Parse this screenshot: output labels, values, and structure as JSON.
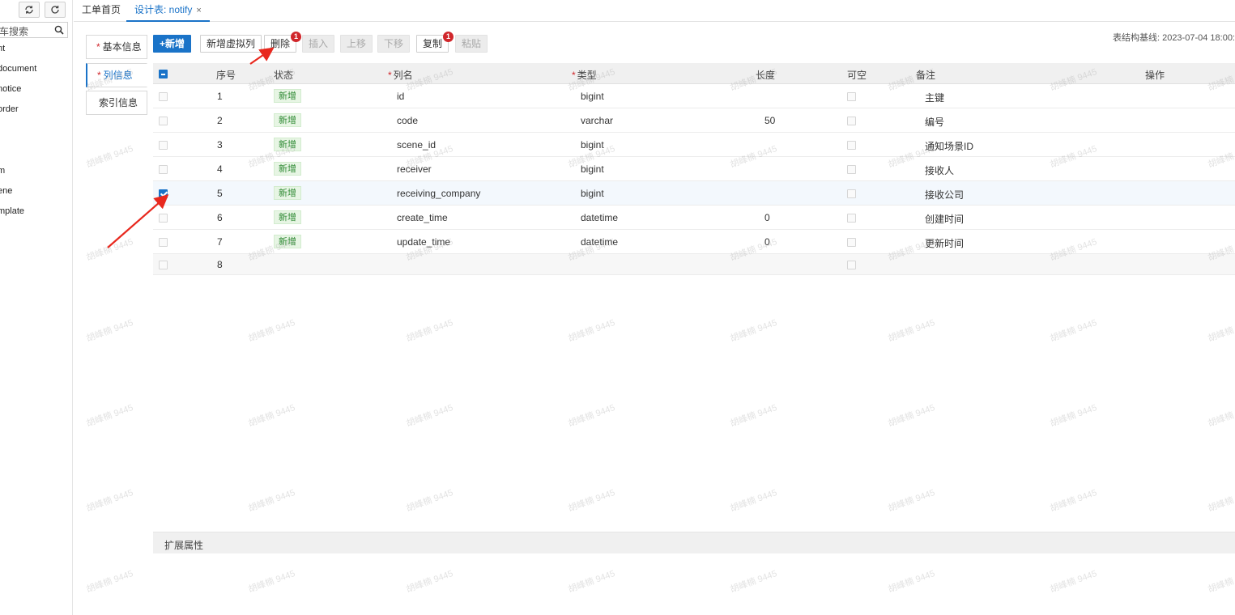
{
  "sidebar": {
    "search_placeholder": "车搜索",
    "items": [
      {
        "label": "nt"
      },
      {
        "label": "document"
      },
      {
        "label": "notice"
      },
      {
        "label": "order"
      },
      {
        "label": "m"
      },
      {
        "label": "ene"
      },
      {
        "label": "mplate"
      }
    ]
  },
  "tabs": {
    "home": "工单首页",
    "active": "设计表: notify",
    "close": "×"
  },
  "section_tabs": [
    {
      "label": "基本信息",
      "required": "*"
    },
    {
      "label": "列信息",
      "required": "*"
    },
    {
      "label": "索引信息",
      "required": ""
    }
  ],
  "toolbar": {
    "add": "+新增",
    "add_virtual": "新增虚拟列",
    "delete": "删除",
    "delete_badge": "1",
    "insert": "插入",
    "move_up": "上移",
    "move_down": "下移",
    "copy": "复制",
    "copy_badge": "1",
    "paste": "粘贴"
  },
  "baseline": "表结构基线: 2023-07-04 18:00:",
  "grid": {
    "headers": {
      "seq": "序号",
      "status": "状态",
      "name": "列名",
      "type": "类型",
      "length": "长度",
      "nullable": "可空",
      "comment": "备注",
      "action": "操作",
      "required": "*"
    },
    "rows": [
      {
        "seq": "1",
        "status": "新增",
        "name": "id",
        "type": "bigint",
        "length": "",
        "comment": "主键",
        "checked": false
      },
      {
        "seq": "2",
        "status": "新增",
        "name": "code",
        "type": "varchar",
        "length": "50",
        "comment": "编号",
        "checked": false
      },
      {
        "seq": "3",
        "status": "新增",
        "name": "scene_id",
        "type": "bigint",
        "length": "",
        "comment": "通知场景ID",
        "checked": false
      },
      {
        "seq": "4",
        "status": "新增",
        "name": "receiver",
        "type": "bigint",
        "length": "",
        "comment": "接收人",
        "checked": false
      },
      {
        "seq": "5",
        "status": "新增",
        "name": "receiving_company",
        "type": "bigint",
        "length": "",
        "comment": "接收公司",
        "checked": true
      },
      {
        "seq": "6",
        "status": "新增",
        "name": "create_time",
        "type": "datetime",
        "length": "0",
        "comment": "创建时间",
        "checked": false
      },
      {
        "seq": "7",
        "status": "新增",
        "name": "update_time",
        "type": "datetime",
        "length": "0",
        "comment": "更新时间",
        "checked": false
      },
      {
        "seq": "8",
        "status": "",
        "name": "",
        "type": "",
        "length": "",
        "comment": "",
        "checked": false
      }
    ]
  },
  "extension": "扩展属性",
  "watermark": "胡峰楠 9445",
  "colors": {
    "accent": "#1a73c8",
    "badge": "#d0262b",
    "status_bg": "#e7f5e4",
    "status_text": "#2f8a34",
    "arrow": "#e8281e"
  }
}
